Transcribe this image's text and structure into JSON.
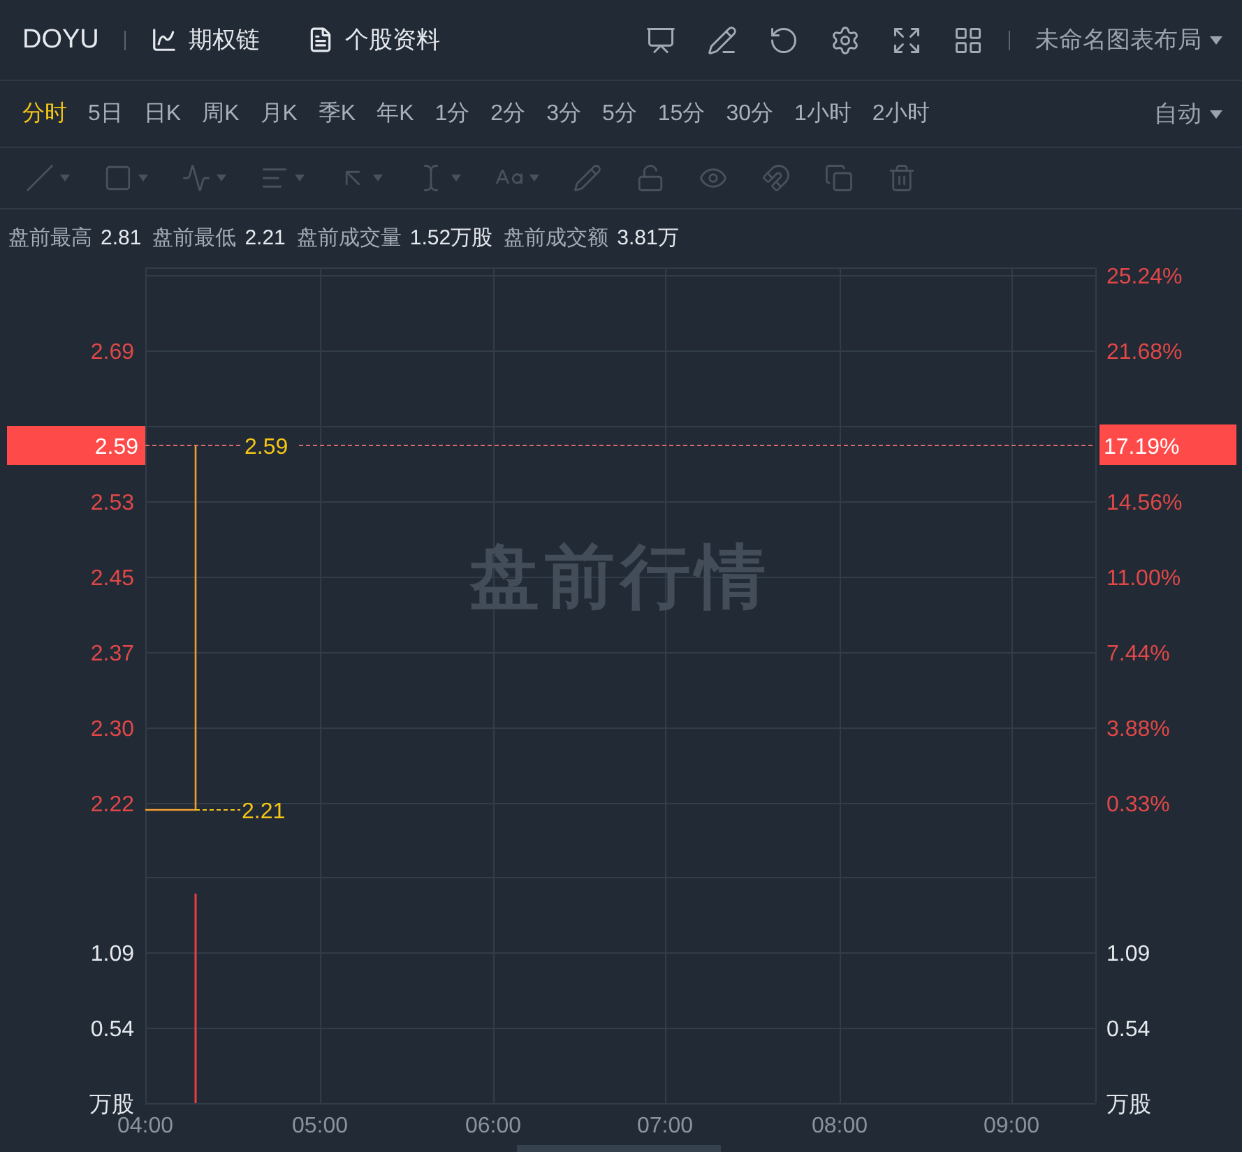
{
  "header": {
    "symbol": "DOYU",
    "links": [
      {
        "kind": "chart",
        "label": "期权链"
      },
      {
        "kind": "doc",
        "label": "个股资料"
      }
    ],
    "tools": [
      {
        "kind": "monitor"
      },
      {
        "kind": "pen"
      },
      {
        "kind": "undo"
      },
      {
        "kind": "settings"
      },
      {
        "kind": "expand"
      },
      {
        "kind": "grid"
      }
    ],
    "layout_menu": "未命名图表布局"
  },
  "periods": [
    {
      "label": "分时",
      "selected": true
    },
    {
      "label": "5日",
      "selected": false
    },
    {
      "label": "日K",
      "selected": false
    },
    {
      "label": "周K",
      "selected": false
    },
    {
      "label": "月K",
      "selected": false
    },
    {
      "label": "季K",
      "selected": false
    },
    {
      "label": "年K",
      "selected": false
    },
    {
      "label": "1分",
      "selected": false
    },
    {
      "label": "2分",
      "selected": false
    },
    {
      "label": "3分",
      "selected": false
    },
    {
      "label": "5分",
      "selected": false
    },
    {
      "label": "15分",
      "selected": false
    },
    {
      "label": "30分",
      "selected": false
    },
    {
      "label": "1小时",
      "selected": false
    },
    {
      "label": "2小时",
      "selected": false
    }
  ],
  "scale_menu": "自动",
  "drawing_tools": [
    {
      "kind": "line",
      "dropdown": true
    },
    {
      "kind": "rect",
      "dropdown": true
    },
    {
      "kind": "wave",
      "dropdown": true
    },
    {
      "kind": "fib",
      "dropdown": true
    },
    {
      "kind": "arrow",
      "dropdown": true
    },
    {
      "kind": "measure",
      "dropdown": true
    },
    {
      "kind": "text",
      "dropdown": true
    },
    {
      "kind": "brush",
      "dropdown": false
    },
    {
      "kind": "lock",
      "dropdown": false
    },
    {
      "kind": "eye",
      "dropdown": false
    },
    {
      "kind": "magnet",
      "dropdown": false
    },
    {
      "kind": "layers",
      "dropdown": false
    },
    {
      "kind": "trash",
      "dropdown": false
    }
  ],
  "info": [
    {
      "label": "盘前最高",
      "value": "2.81"
    },
    {
      "label": "盘前最低",
      "value": "2.21"
    },
    {
      "label": "盘前成交量",
      "value": "1.52万股"
    },
    {
      "label": "盘前成交额",
      "value": "3.81万"
    }
  ],
  "price_chart": {
    "watermark": "盘前行情",
    "price_ticks": [
      "2.69",
      "2.53",
      "2.45",
      "2.37",
      "2.30",
      "2.22"
    ],
    "percent_ticks": [
      "25.24%",
      "21.68%",
      "14.56%",
      "11.00%",
      "7.44%",
      "3.88%",
      "0.33%"
    ],
    "high_label": "2.59",
    "low_label": "2.21",
    "last_price": "2.59",
    "last_percent": "17.19%"
  },
  "volume_chart": {
    "left_ticks": [
      "1.09",
      "0.54"
    ],
    "left_unit": "万股",
    "right_ticks": [
      "1.09",
      "0.54"
    ],
    "right_unit": "万股"
  },
  "time_labels": [
    "04:00",
    "05:00",
    "06:00",
    "07:00",
    "08:00",
    "09:00"
  ]
}
